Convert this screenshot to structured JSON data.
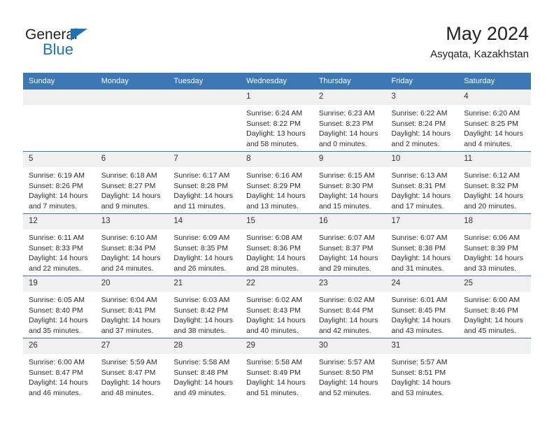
{
  "brand": {
    "name_part1": "General",
    "name_part2": "Blue",
    "accent_color": "#1a72b8"
  },
  "header": {
    "title": "May 2024",
    "location": "Asyqata, Kazakhstan",
    "header_bg": "#3b78b5",
    "daynum_bg": "#f0f0f0"
  },
  "weekdays": [
    "Sunday",
    "Monday",
    "Tuesday",
    "Wednesday",
    "Thursday",
    "Friday",
    "Saturday"
  ],
  "weeks": [
    [
      {
        "day": "",
        "blank": true,
        "sunrise": "",
        "sunset": "",
        "daylight1": "",
        "daylight2": ""
      },
      {
        "day": "",
        "blank": true,
        "sunrise": "",
        "sunset": "",
        "daylight1": "",
        "daylight2": ""
      },
      {
        "day": "",
        "blank": true,
        "sunrise": "",
        "sunset": "",
        "daylight1": "",
        "daylight2": ""
      },
      {
        "day": "1",
        "sunrise": "Sunrise: 6:24 AM",
        "sunset": "Sunset: 8:22 PM",
        "daylight1": "Daylight: 13 hours",
        "daylight2": "and 58 minutes."
      },
      {
        "day": "2",
        "sunrise": "Sunrise: 6:23 AM",
        "sunset": "Sunset: 8:23 PM",
        "daylight1": "Daylight: 14 hours",
        "daylight2": "and 0 minutes."
      },
      {
        "day": "3",
        "sunrise": "Sunrise: 6:22 AM",
        "sunset": "Sunset: 8:24 PM",
        "daylight1": "Daylight: 14 hours",
        "daylight2": "and 2 minutes."
      },
      {
        "day": "4",
        "sunrise": "Sunrise: 6:20 AM",
        "sunset": "Sunset: 8:25 PM",
        "daylight1": "Daylight: 14 hours",
        "daylight2": "and 4 minutes."
      }
    ],
    [
      {
        "day": "5",
        "sunrise": "Sunrise: 6:19 AM",
        "sunset": "Sunset: 8:26 PM",
        "daylight1": "Daylight: 14 hours",
        "daylight2": "and 7 minutes."
      },
      {
        "day": "6",
        "sunrise": "Sunrise: 6:18 AM",
        "sunset": "Sunset: 8:27 PM",
        "daylight1": "Daylight: 14 hours",
        "daylight2": "and 9 minutes."
      },
      {
        "day": "7",
        "sunrise": "Sunrise: 6:17 AM",
        "sunset": "Sunset: 8:28 PM",
        "daylight1": "Daylight: 14 hours",
        "daylight2": "and 11 minutes."
      },
      {
        "day": "8",
        "sunrise": "Sunrise: 6:16 AM",
        "sunset": "Sunset: 8:29 PM",
        "daylight1": "Daylight: 14 hours",
        "daylight2": "and 13 minutes."
      },
      {
        "day": "9",
        "sunrise": "Sunrise: 6:15 AM",
        "sunset": "Sunset: 8:30 PM",
        "daylight1": "Daylight: 14 hours",
        "daylight2": "and 15 minutes."
      },
      {
        "day": "10",
        "sunrise": "Sunrise: 6:13 AM",
        "sunset": "Sunset: 8:31 PM",
        "daylight1": "Daylight: 14 hours",
        "daylight2": "and 17 minutes."
      },
      {
        "day": "11",
        "sunrise": "Sunrise: 6:12 AM",
        "sunset": "Sunset: 8:32 PM",
        "daylight1": "Daylight: 14 hours",
        "daylight2": "and 20 minutes."
      }
    ],
    [
      {
        "day": "12",
        "sunrise": "Sunrise: 6:11 AM",
        "sunset": "Sunset: 8:33 PM",
        "daylight1": "Daylight: 14 hours",
        "daylight2": "and 22 minutes."
      },
      {
        "day": "13",
        "sunrise": "Sunrise: 6:10 AM",
        "sunset": "Sunset: 8:34 PM",
        "daylight1": "Daylight: 14 hours",
        "daylight2": "and 24 minutes."
      },
      {
        "day": "14",
        "sunrise": "Sunrise: 6:09 AM",
        "sunset": "Sunset: 8:35 PM",
        "daylight1": "Daylight: 14 hours",
        "daylight2": "and 26 minutes."
      },
      {
        "day": "15",
        "sunrise": "Sunrise: 6:08 AM",
        "sunset": "Sunset: 8:36 PM",
        "daylight1": "Daylight: 14 hours",
        "daylight2": "and 28 minutes."
      },
      {
        "day": "16",
        "sunrise": "Sunrise: 6:07 AM",
        "sunset": "Sunset: 8:37 PM",
        "daylight1": "Daylight: 14 hours",
        "daylight2": "and 29 minutes."
      },
      {
        "day": "17",
        "sunrise": "Sunrise: 6:07 AM",
        "sunset": "Sunset: 8:38 PM",
        "daylight1": "Daylight: 14 hours",
        "daylight2": "and 31 minutes."
      },
      {
        "day": "18",
        "sunrise": "Sunrise: 6:06 AM",
        "sunset": "Sunset: 8:39 PM",
        "daylight1": "Daylight: 14 hours",
        "daylight2": "and 33 minutes."
      }
    ],
    [
      {
        "day": "19",
        "sunrise": "Sunrise: 6:05 AM",
        "sunset": "Sunset: 8:40 PM",
        "daylight1": "Daylight: 14 hours",
        "daylight2": "and 35 minutes."
      },
      {
        "day": "20",
        "sunrise": "Sunrise: 6:04 AM",
        "sunset": "Sunset: 8:41 PM",
        "daylight1": "Daylight: 14 hours",
        "daylight2": "and 37 minutes."
      },
      {
        "day": "21",
        "sunrise": "Sunrise: 6:03 AM",
        "sunset": "Sunset: 8:42 PM",
        "daylight1": "Daylight: 14 hours",
        "daylight2": "and 38 minutes."
      },
      {
        "day": "22",
        "sunrise": "Sunrise: 6:02 AM",
        "sunset": "Sunset: 8:43 PM",
        "daylight1": "Daylight: 14 hours",
        "daylight2": "and 40 minutes."
      },
      {
        "day": "23",
        "sunrise": "Sunrise: 6:02 AM",
        "sunset": "Sunset: 8:44 PM",
        "daylight1": "Daylight: 14 hours",
        "daylight2": "and 42 minutes."
      },
      {
        "day": "24",
        "sunrise": "Sunrise: 6:01 AM",
        "sunset": "Sunset: 8:45 PM",
        "daylight1": "Daylight: 14 hours",
        "daylight2": "and 43 minutes."
      },
      {
        "day": "25",
        "sunrise": "Sunrise: 6:00 AM",
        "sunset": "Sunset: 8:46 PM",
        "daylight1": "Daylight: 14 hours",
        "daylight2": "and 45 minutes."
      }
    ],
    [
      {
        "day": "26",
        "sunrise": "Sunrise: 6:00 AM",
        "sunset": "Sunset: 8:47 PM",
        "daylight1": "Daylight: 14 hours",
        "daylight2": "and 46 minutes."
      },
      {
        "day": "27",
        "sunrise": "Sunrise: 5:59 AM",
        "sunset": "Sunset: 8:47 PM",
        "daylight1": "Daylight: 14 hours",
        "daylight2": "and 48 minutes."
      },
      {
        "day": "28",
        "sunrise": "Sunrise: 5:58 AM",
        "sunset": "Sunset: 8:48 PM",
        "daylight1": "Daylight: 14 hours",
        "daylight2": "and 49 minutes."
      },
      {
        "day": "29",
        "sunrise": "Sunrise: 5:58 AM",
        "sunset": "Sunset: 8:49 PM",
        "daylight1": "Daylight: 14 hours",
        "daylight2": "and 51 minutes."
      },
      {
        "day": "30",
        "sunrise": "Sunrise: 5:57 AM",
        "sunset": "Sunset: 8:50 PM",
        "daylight1": "Daylight: 14 hours",
        "daylight2": "and 52 minutes."
      },
      {
        "day": "31",
        "sunrise": "Sunrise: 5:57 AM",
        "sunset": "Sunset: 8:51 PM",
        "daylight1": "Daylight: 14 hours",
        "daylight2": "and 53 minutes."
      },
      {
        "day": "",
        "blank": true,
        "sunrise": "",
        "sunset": "",
        "daylight1": "",
        "daylight2": ""
      }
    ]
  ]
}
